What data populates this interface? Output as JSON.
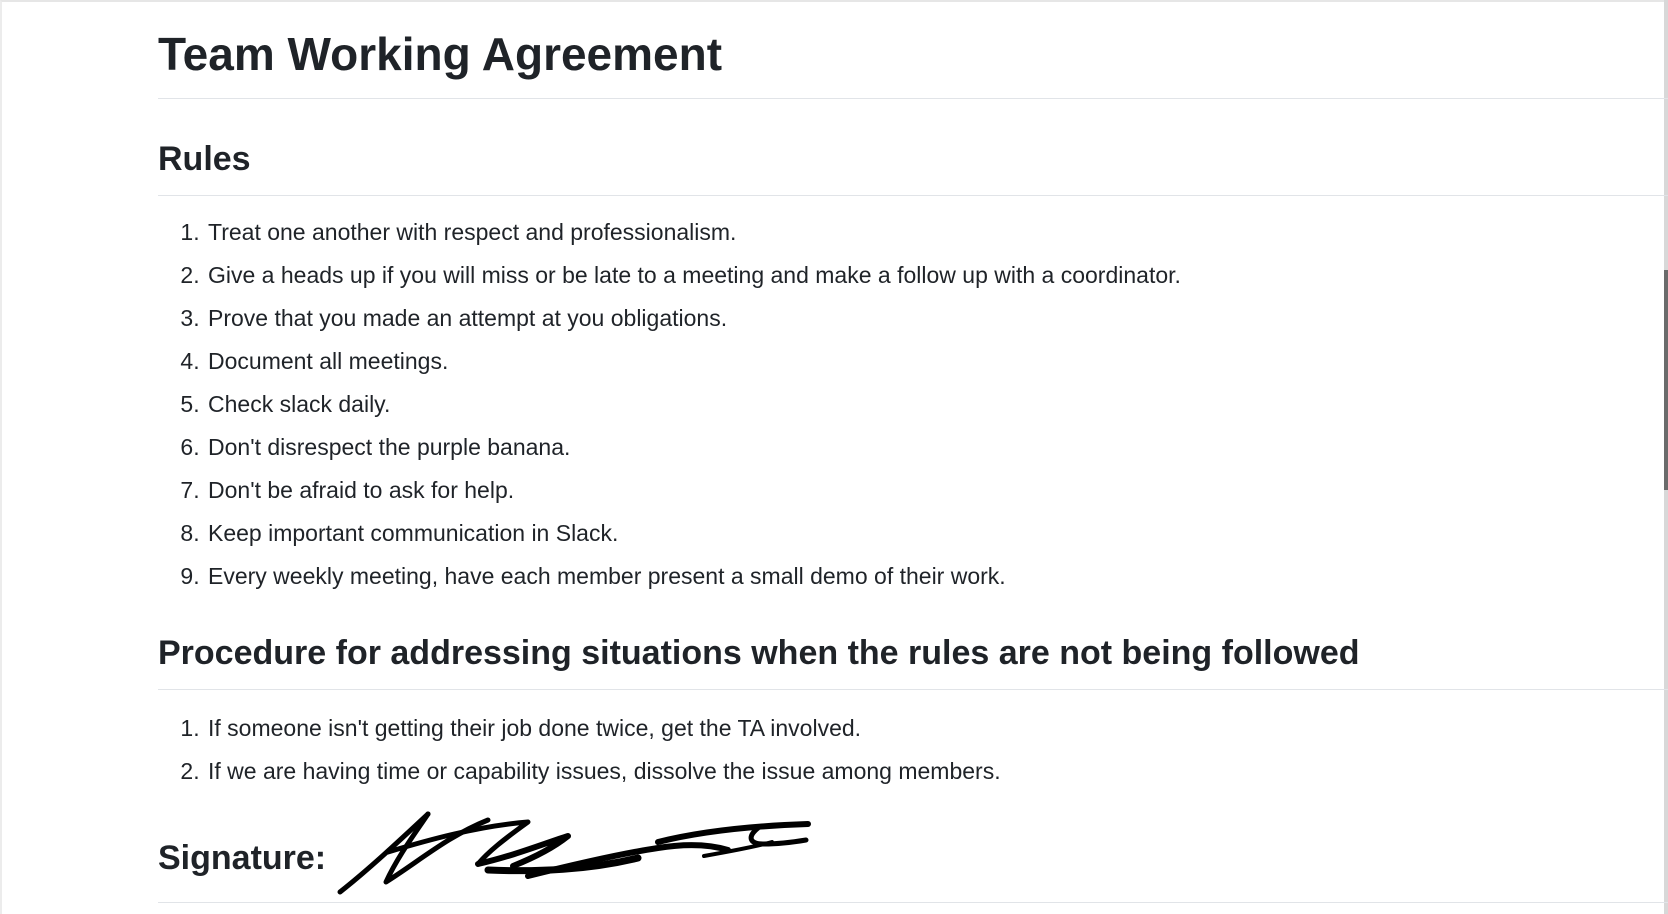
{
  "document": {
    "title": "Team Working Agreement",
    "sections": {
      "rules": {
        "heading": "Rules",
        "items": [
          "Treat one another with respect and professionalism.",
          "Give a heads up if you will miss or be late to a meeting and make a follow up with a coordinator.",
          "Prove that you made an attempt at you obligations.",
          "Document all meetings.",
          "Check slack daily.",
          "Don't disrespect the purple banana.",
          "Don't be afraid to ask for help.",
          "Keep important communication in Slack.",
          "Every weekly meeting, have each member present a small demo of their work."
        ]
      },
      "procedure": {
        "heading": "Procedure for addressing situations when the rules are not being followed",
        "items": [
          "If someone isn't getting their job done twice, get the TA involved.",
          "If we are having time or capability issues, dissolve the issue among members."
        ]
      }
    },
    "signature": {
      "label": "Signature:"
    }
  },
  "colors": {
    "text": "#1f2328",
    "rule_line": "#e1e4e8",
    "ink": "#000000"
  }
}
